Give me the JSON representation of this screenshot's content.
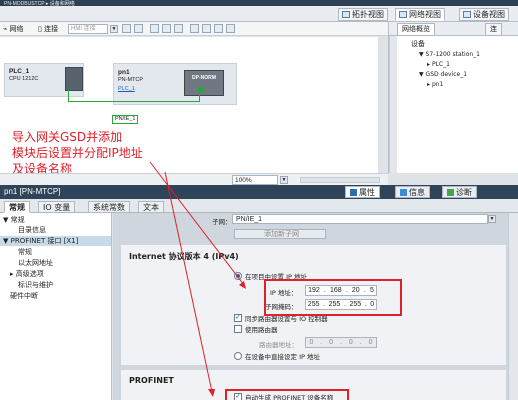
{
  "titlebar": {
    "text": "PN-MODBUSTCP ▸ 设备和网络"
  },
  "views": {
    "topology": "拓扑视图",
    "network": "网络视图",
    "device": "设备视图"
  },
  "toolbar": {
    "network_label": "网络",
    "connection_label": "连接",
    "hmi_placeholder": "HMI 连接"
  },
  "canvas": {
    "plc": {
      "name": "PLC_1",
      "type": "CPU 1212C"
    },
    "pn": {
      "name": "pn1",
      "type": "PN-MTCP",
      "link": "PLC_1",
      "module": "DP-NORM"
    },
    "network_label": "PN/IE_1"
  },
  "overview": {
    "tab_network": "网络概览",
    "tab_connection": "连",
    "tree": [
      {
        "label": "设备",
        "indent": 0,
        "toggle": ""
      },
      {
        "label": "S7-1200 station_1",
        "indent": 1,
        "toggle": "▼"
      },
      {
        "label": "PLC_1",
        "indent": 2,
        "toggle": "▸"
      },
      {
        "label": "GSD device_1",
        "indent": 1,
        "toggle": "▼"
      },
      {
        "label": "pn1",
        "indent": 2,
        "toggle": "▸"
      }
    ]
  },
  "annotation": {
    "lines": [
      "导入网关GSD并添加",
      "模块后设置并分配IP地址",
      "及设备名称"
    ]
  },
  "zoom": {
    "value": "100%"
  },
  "properties": {
    "title": "pn1 [PN-MTCP]",
    "btn_properties": "属性",
    "btn_info": "信息",
    "btn_diagnostics": "诊断",
    "tabs": [
      "常规",
      "IO 变量",
      "系统常数",
      "文本"
    ],
    "nav": [
      {
        "label": "常规",
        "indent": 0,
        "toggle": "▼",
        "selected": false
      },
      {
        "label": "目录信息",
        "indent": 1,
        "toggle": "",
        "selected": false
      },
      {
        "label": "PROFINET 接口 [X1]",
        "indent": 0,
        "toggle": "▼",
        "selected": true
      },
      {
        "label": "常规",
        "indent": 1,
        "toggle": "",
        "selected": false
      },
      {
        "label": "以太网地址",
        "indent": 1,
        "toggle": "",
        "selected": false
      },
      {
        "label": "高级选项",
        "indent": 1,
        "toggle": "▸",
        "selected": false
      },
      {
        "label": "标识与维护",
        "indent": 1,
        "toggle": "",
        "selected": false
      },
      {
        "label": "硬件中断",
        "indent": 0,
        "toggle": "",
        "selected": false
      }
    ],
    "subnet_label": "子网：",
    "subnet_value": "PN/IE_1",
    "add_subnet": "添加新子网",
    "ipv4": {
      "section_title": "Internet 协议版本 4 (IPv4)",
      "radio_set_in_project": "在项目中设置 IP 地址",
      "ip_label": "IP 地址：",
      "ip": [
        "192",
        "168",
        "20",
        "5"
      ],
      "mask_label": "子网掩码：",
      "mask": [
        "255",
        "255",
        "255",
        "0"
      ],
      "sync_router": "同步路由器设置与 IO 控制器",
      "use_router": "使用路由器",
      "router_label": "路由器地址：",
      "router": [
        "0",
        "0",
        "0",
        "0"
      ],
      "radio_set_on_device": "在设备中直接设定 IP 地址"
    },
    "profinet": {
      "section_title": "PROFINET",
      "auto_name": "自动生成 PROFINET 设备名称"
    }
  },
  "colors": {
    "annotation_red": "#e0202a",
    "network_green": "#24a83a",
    "header_blue": "#2f4459"
  }
}
